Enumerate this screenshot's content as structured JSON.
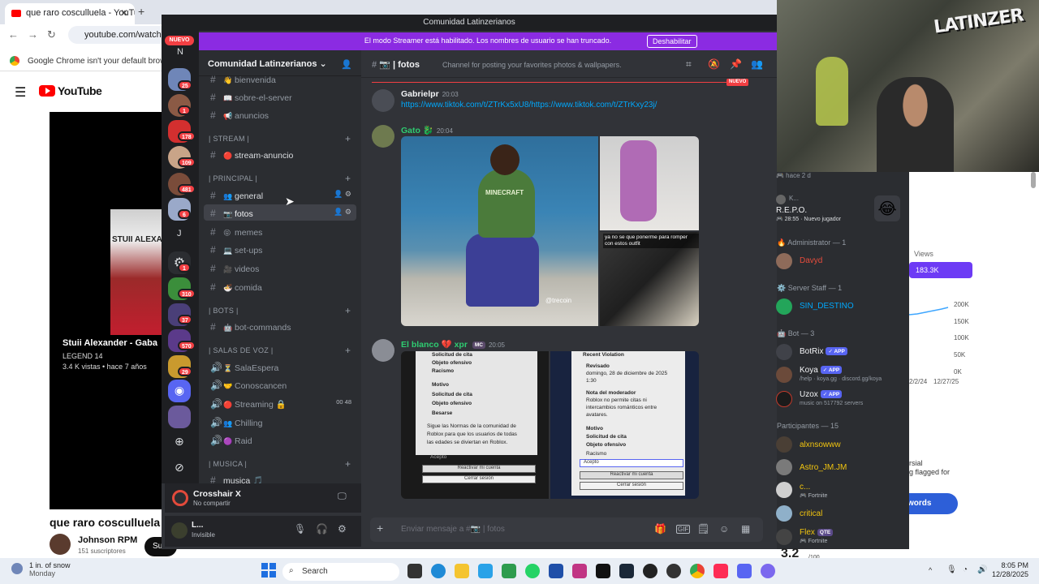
{
  "chrome": {
    "tab_title": "que raro cosculluela - YouTube",
    "omnibox": "youtube.com/watch?v=",
    "infobar": "Google Chrome isn't your default browser"
  },
  "youtube": {
    "logo": "YouTube",
    "video_card_title": "Stuii Alexander - Gaba",
    "video_card_sub1": "LEGEND 14",
    "video_card_sub2": "3.4 K vistas • hace 7 años",
    "thumb_text": "STUII ALEXAN",
    "main_title": "que raro cosculluela",
    "channel": "Johnson RPM",
    "subs": "151 suscriptores",
    "subscribe_btn": "Su"
  },
  "analytics": {
    "views_label": "Views",
    "views_value": "183.3K",
    "ticks": [
      "200K",
      "150K",
      "100K",
      "50K",
      "0K"
    ],
    "dates": [
      "2/2/24",
      "12/27/25"
    ],
    "flag_text": [
      "rsial",
      "g flagged for"
    ],
    "words_btn": "words"
  },
  "webcam": {
    "logo_text": "LATINZER"
  },
  "discord": {
    "window_title": "Comunidad Latinzerianos",
    "streamer_banner": "El modo Streamer está habilitado. Los nombres de usuario se han truncado.",
    "streamer_btn": "Deshabilitar",
    "rail": {
      "new_badge": "NUEVO",
      "letters": [
        "N",
        "J"
      ],
      "badges": [
        "4",
        "25",
        "1",
        "178",
        "109",
        "481",
        "6",
        "1",
        "310",
        "37",
        "570",
        "29"
      ]
    },
    "server_name": "Comunidad Latinzerianos",
    "channels": {
      "top": [
        {
          "name": "bienvenida",
          "emoji": "👋"
        },
        {
          "name": "sobre-el-server",
          "emoji": "📖"
        },
        {
          "name": "anuncios",
          "emoji": "📢"
        }
      ],
      "cat_stream": "| STREAM |",
      "stream": [
        {
          "name": "stream-anuncio",
          "emoji": "🔴"
        }
      ],
      "cat_principal": "| PRINCIPAL |",
      "principal": [
        {
          "name": "general",
          "emoji": "👥"
        },
        {
          "name": "fotos",
          "emoji": "📷"
        },
        {
          "name": "memes",
          "emoji": "😝"
        },
        {
          "name": "set-ups",
          "emoji": "💻"
        },
        {
          "name": "videos",
          "emoji": "🎥"
        },
        {
          "name": "comida",
          "emoji": "🍜"
        }
      ],
      "cat_bots": "| BOTS |",
      "bots": [
        {
          "name": "bot-commands",
          "emoji": "🤖"
        }
      ],
      "cat_voz": "| SALAS DE VOZ |",
      "voz": [
        {
          "name": "SalaEspera",
          "emoji": "⏳"
        },
        {
          "name": "Conoscancen",
          "emoji": "🤝"
        },
        {
          "name": "Streaming 🔒",
          "emoji": "🔴"
        },
        {
          "name": "Chilling",
          "emoji": "👥"
        },
        {
          "name": "Raid",
          "emoji": "🟣"
        }
      ],
      "streaming_counts": [
        "00",
        "48"
      ],
      "cat_musica": "| MUSICA |",
      "musica": [
        {
          "name": "musica 🎵",
          "emoji": ""
        }
      ]
    },
    "voice_panel": {
      "name": "Crosshair X",
      "status": "No compartir"
    },
    "user_panel": {
      "name": "L...",
      "status": "Invisible"
    },
    "chat": {
      "channel_title": "fotos",
      "channel_topic": "Channel for posting your favorites photos & wallpapers.",
      "new_label": "NUEVO",
      "messages": [
        {
          "author": "Gabrielpr",
          "time": "20:03",
          "text": "https://www.tiktok.com/t/ZTrKx5xU8/https://www.tiktok.com/t/ZTrKxy23j/",
          "color": "#f2f3f5"
        },
        {
          "author": "Gato 🐉",
          "time": "20:04",
          "color": "#2ecc71"
        },
        {
          "author": "El blanco 💔 xpr",
          "tag": "MC",
          "time": "20:05",
          "color": "#2ecc71"
        }
      ],
      "img_a_text": "MINECRAFT",
      "img_a_tiktok": "@trecoin",
      "img_c_caption": "ya no se que ponerme para romper con estos outfit",
      "screenshot_left": [
        "Solicitud de cita",
        "Objeto ofensivo",
        "Racismo",
        "Motivo",
        "Solicitud de cita",
        "Objeto ofensivo",
        "Besarse",
        "Sigue las Normas de la comunidad de",
        "Roblox para que los usuarios de todas",
        "las edades se diviertan en Roblox.",
        "Acepto",
        "Reactivar mi cuenta",
        "Cerrar sesión"
      ],
      "screenshot_right": [
        "Recent Violation",
        "Revisado",
        "domingo, 28 de diciembre de 2025",
        "1:30",
        "Nota del moderador",
        "Roblox no permite citas ni",
        "intercambios románticos entre",
        "avatares.",
        "Motivo",
        "Solicitud de cita",
        "Objeto ofensivo",
        "Racismo",
        "Acepto",
        "Reactivar mi cuenta",
        "Cerrar sesión"
      ],
      "composer_placeholder": "Enviar mensaje a #📷 | fotos"
    },
    "members": {
      "activity_top": "🎮 hace 2 d",
      "activity_user": "K...",
      "activity_game": "R.E.P.O.",
      "activity_detail": "🎮 28:55 · Nuevo jugador",
      "groups": [
        {
          "title": "🔥 Administrator — 1",
          "members": [
            {
              "name": "Davyd",
              "color": "#e74c3c"
            }
          ]
        },
        {
          "title": "⚙️ Server Staff — 1",
          "members": [
            {
              "name": "SIN_DESTINO",
              "color": "#00a8fc"
            }
          ]
        },
        {
          "title": "🤖 Bot — 3",
          "members": [
            {
              "name": "BotRix",
              "color": "#f2f3f5",
              "sub": ""
            },
            {
              "name": "Koya",
              "color": "#f2f3f5",
              "sub": "/help · koya.gg · discord.gg/koya"
            },
            {
              "name": "Uzox",
              "color": "#f2f3f5",
              "sub": "music on 517792 servers"
            }
          ]
        },
        {
          "title": "Participantes — 15",
          "members": [
            {
              "name": "alxnsowww",
              "color": "#f1c40f",
              "sub": ""
            },
            {
              "name": "Astro_JM.JM",
              "color": "#f1c40f",
              "sub": ""
            },
            {
              "name": "c...",
              "color": "#f1c40f",
              "sub": "🎮 Fortnite"
            },
            {
              "name": "critical",
              "color": "#f1c40f",
              "sub": ""
            },
            {
              "name": "Flex",
              "color": "#f1c40f",
              "sub": "🎮 Fortnite"
            }
          ]
        }
      ],
      "app_tag": "APP",
      "qte_tag": "QTE"
    }
  },
  "taskbar": {
    "weather_line1": "1 in. of snow",
    "weather_line2": "Monday",
    "search": "Search",
    "time": "8:05 PM",
    "date": "12/28/2025",
    "overlay_num": "3.2",
    "overlay_sub": "/100"
  }
}
